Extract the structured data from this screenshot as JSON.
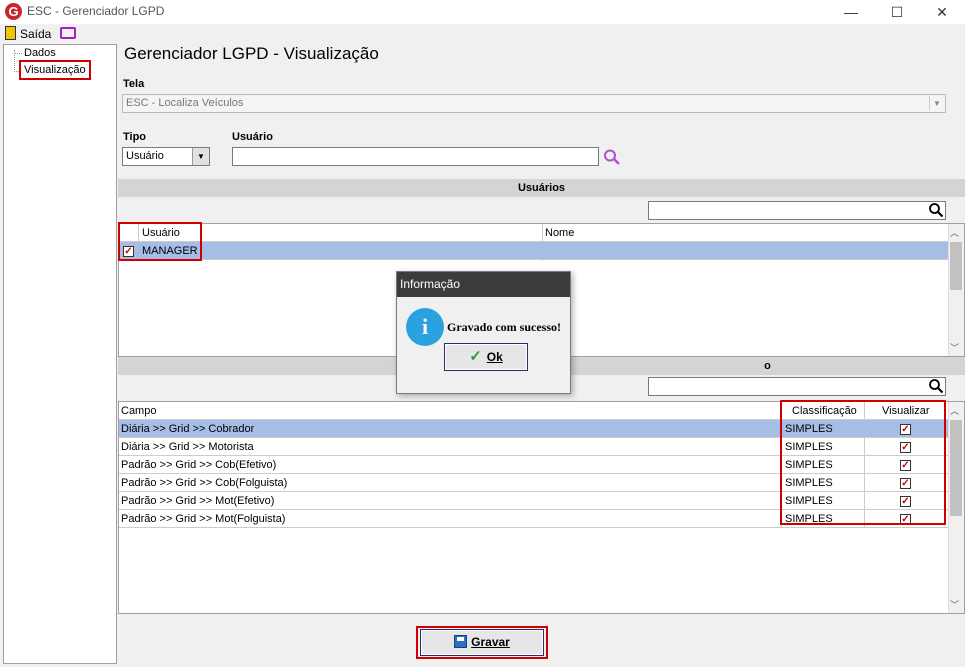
{
  "window": {
    "title": "ESC - Gerenciador LGPD",
    "logo_letter": "G"
  },
  "toolbar": {
    "exit_label": "Saída"
  },
  "tree": {
    "items": [
      "Dados",
      "Visualização"
    ]
  },
  "page": {
    "title": "Gerenciador LGPD - Visualização"
  },
  "form": {
    "tela_label": "Tela",
    "tela_value": "ESC - Localiza Veículos",
    "tipo_label": "Tipo",
    "tipo_value": "Usuário",
    "usuario_label": "Usuário",
    "usuario_value": ""
  },
  "usuarios_section": {
    "title": "Usuários",
    "columns": [
      "Usuário",
      "Nome"
    ],
    "rows": [
      {
        "checked": true,
        "usuario": "MANAGER",
        "nome": ""
      }
    ]
  },
  "campos_section": {
    "title_suffix": "o",
    "columns": [
      "Campo",
      "Classificação",
      "Visualizar"
    ],
    "rows": [
      {
        "campo": "Diária >> Grid >> Cobrador",
        "classificacao": "SIMPLES",
        "visualizar": true
      },
      {
        "campo": "Diária >> Grid >> Motorista",
        "classificacao": "SIMPLES",
        "visualizar": true
      },
      {
        "campo": "Padrão >> Grid >> Cob(Efetivo)",
        "classificacao": "SIMPLES",
        "visualizar": true
      },
      {
        "campo": "Padrão >> Grid >> Cob(Folguista)",
        "classificacao": "SIMPLES",
        "visualizar": true
      },
      {
        "campo": "Padrão >> Grid >> Mot(Efetivo)",
        "classificacao": "SIMPLES",
        "visualizar": true
      },
      {
        "campo": "Padrão >> Grid >> Mot(Folguista)",
        "classificacao": "SIMPLES",
        "visualizar": true
      }
    ]
  },
  "dialog": {
    "title": "Informação",
    "message": "Gravado com sucesso!",
    "ok_label": "Ok"
  },
  "footer": {
    "save_label": "Gravar"
  },
  "colors": {
    "highlight": "#d00000",
    "selection": "#a6bde6",
    "accent": "#a020c0"
  }
}
